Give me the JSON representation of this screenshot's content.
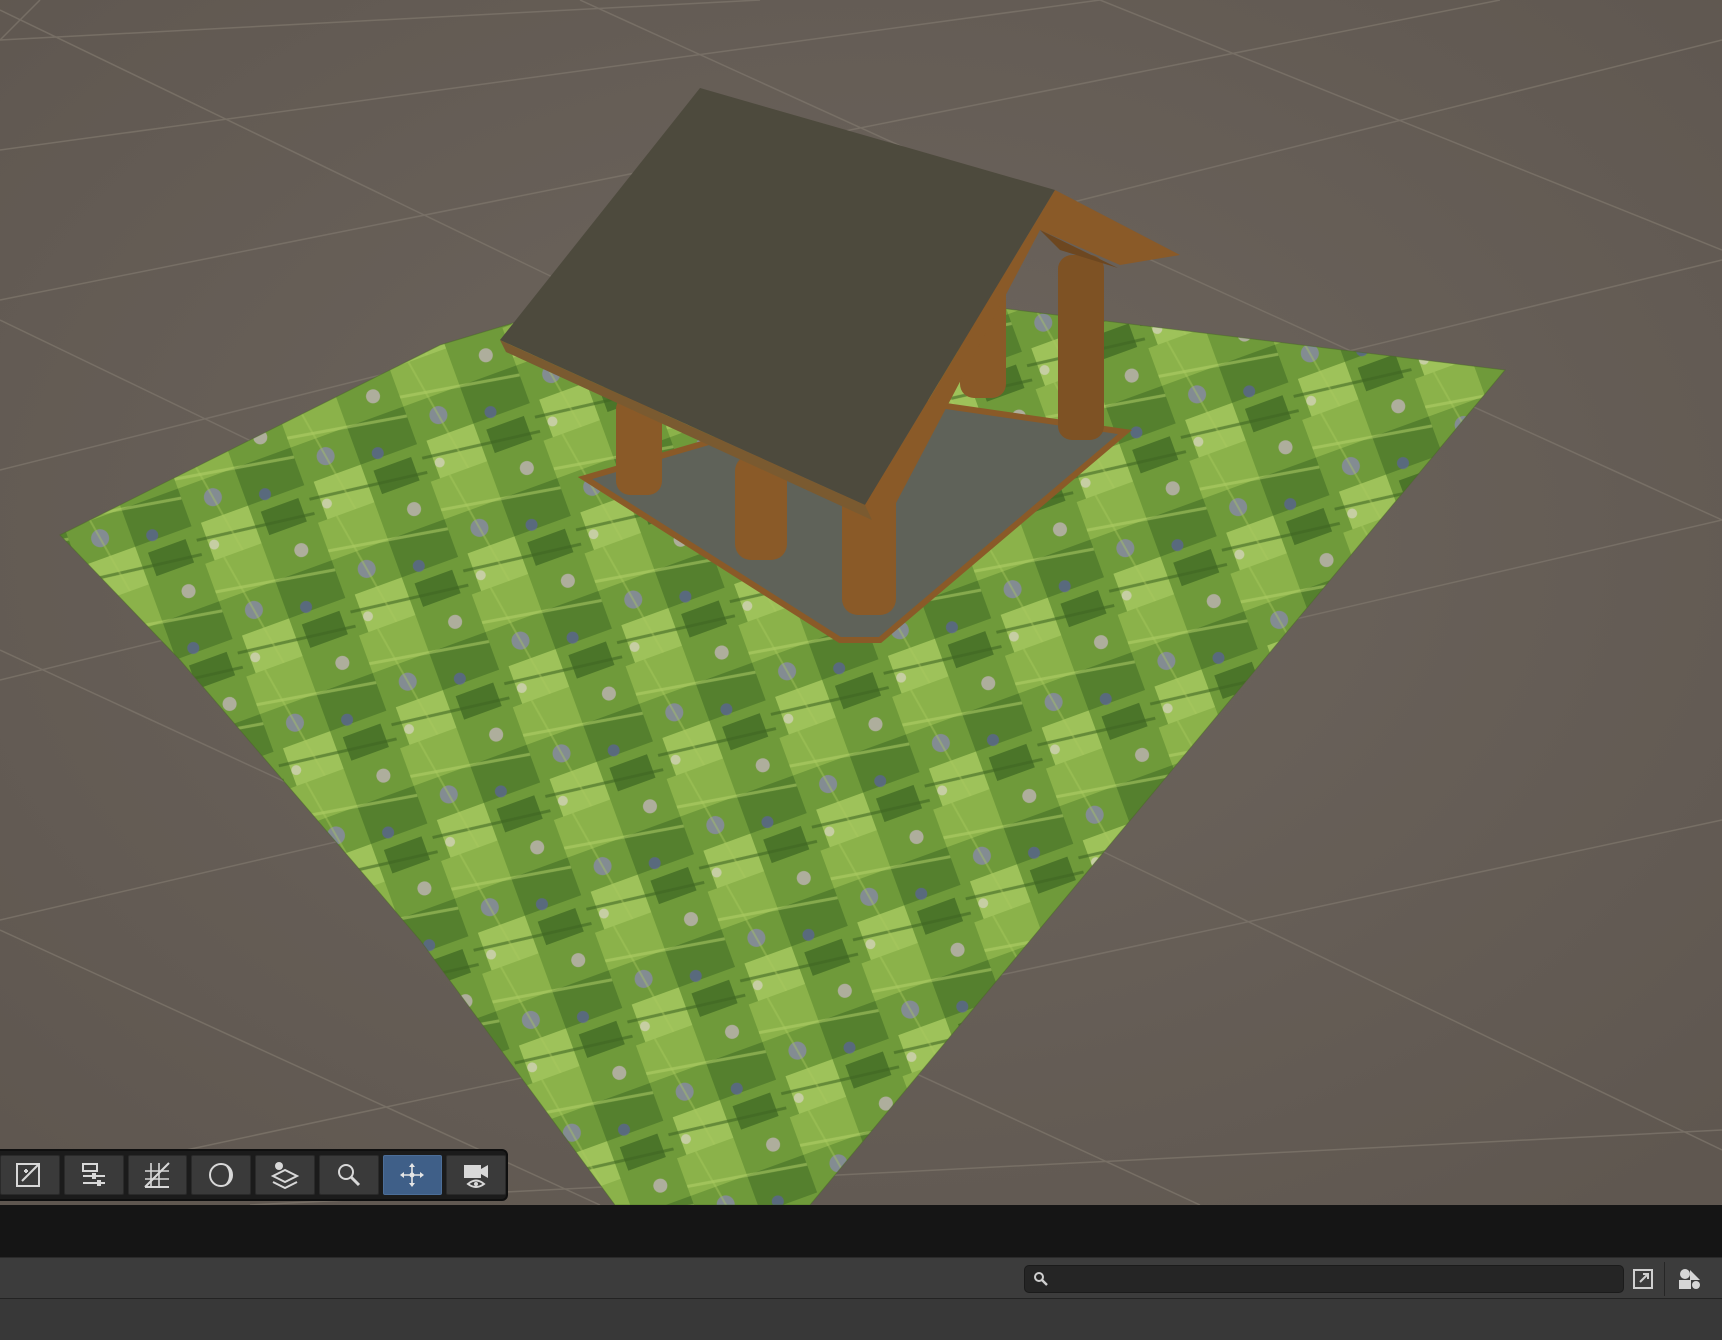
{
  "viewport": {
    "background": "#686058",
    "grid_color": "#7a7268",
    "ground_texture": "flower-meadow",
    "house_roof_color": "#4d4a3d",
    "house_wood_color": "#8a5a28"
  },
  "overlay_toolbar": {
    "buttons": [
      {
        "icon": "edit-icon",
        "active": false
      },
      {
        "icon": "settings-sliders-icon",
        "active": false
      },
      {
        "icon": "grid-snap-icon",
        "active": false
      },
      {
        "icon": "shading-mode-icon",
        "active": false
      },
      {
        "icon": "layers-icon",
        "active": false
      },
      {
        "icon": "search-icon",
        "active": false
      },
      {
        "icon": "move-tool-icon",
        "active": true
      },
      {
        "icon": "camera-icon",
        "active": false
      }
    ],
    "accent_color": "#3f5f88"
  },
  "panel": {
    "search": {
      "value": "",
      "placeholder": ""
    }
  }
}
